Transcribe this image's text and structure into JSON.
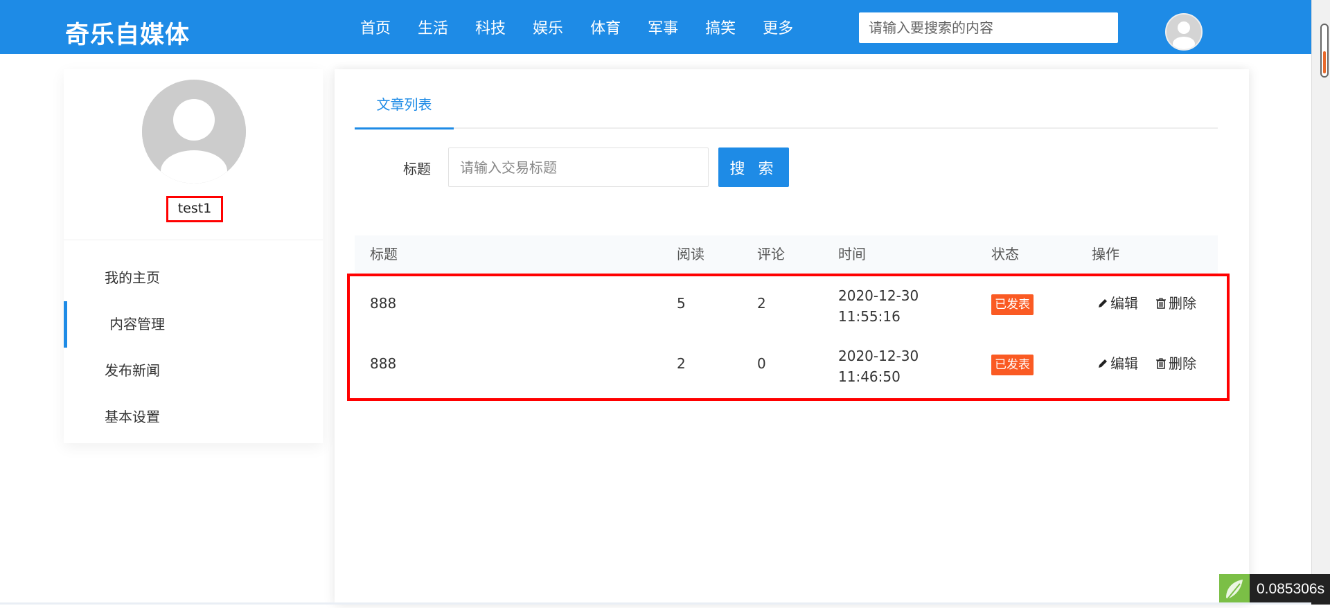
{
  "header": {
    "logo": "奇乐自媒体",
    "nav": [
      "首页",
      "生活",
      "科技",
      "娱乐",
      "体育",
      "军事",
      "搞笑",
      "更多"
    ],
    "search_placeholder": "请输入要搜索的内容",
    "brand_color": "#1e8be6"
  },
  "sidebar": {
    "username": "test1",
    "menu": [
      {
        "label": "我的主页",
        "active": false
      },
      {
        "label": "内容管理",
        "active": true
      },
      {
        "label": "发布新闻",
        "active": false
      },
      {
        "label": "基本设置",
        "active": false
      }
    ]
  },
  "main": {
    "tab": "文章列表",
    "filter_label": "标题",
    "filter_placeholder": "请输入交易标题",
    "search_button": "搜 索",
    "table": {
      "headers": [
        "标题",
        "阅读",
        "评论",
        "时间",
        "状态",
        "操作"
      ],
      "rows": [
        {
          "title": "888",
          "reads": "5",
          "comments": "2",
          "date": "2020-12-30",
          "time": "11:55:16",
          "status": "已发表",
          "edit": "编辑",
          "delete": "删除"
        },
        {
          "title": "888",
          "reads": "2",
          "comments": "0",
          "date": "2020-12-30",
          "time": "11:46:50",
          "status": "已发表",
          "edit": "编辑",
          "delete": "删除"
        }
      ]
    },
    "status_color": "#fa5a23"
  },
  "timer": {
    "value": "0.085306s"
  },
  "icons": [
    "user-avatar-icon",
    "pencil-icon",
    "trash-icon"
  ]
}
